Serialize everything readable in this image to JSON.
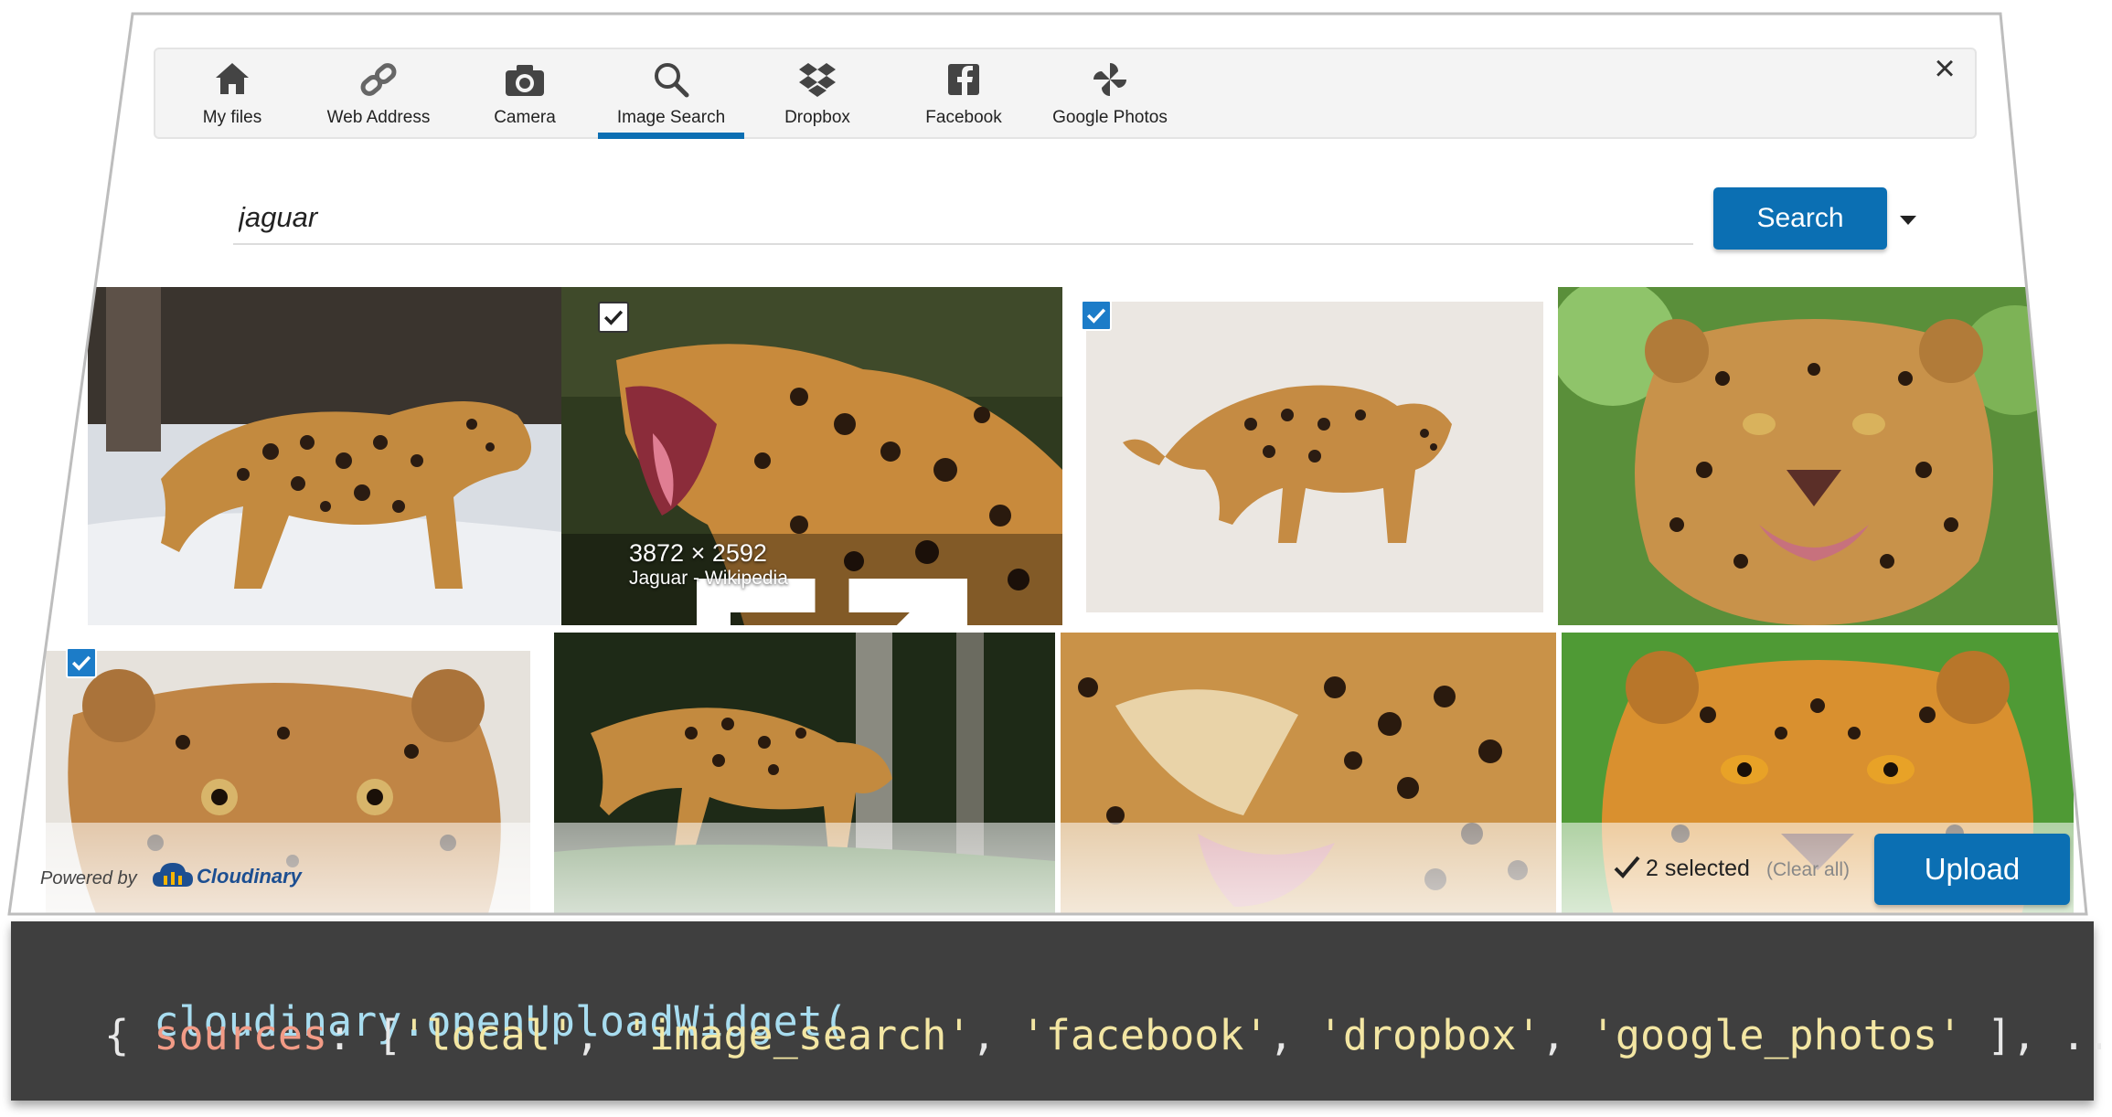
{
  "tabs": [
    {
      "label": "My files",
      "icon": "home-icon"
    },
    {
      "label": "Web Address",
      "icon": "link-icon"
    },
    {
      "label": "Camera",
      "icon": "camera-icon"
    },
    {
      "label": "Image Search",
      "icon": "search-icon",
      "active": true
    },
    {
      "label": "Dropbox",
      "icon": "dropbox-icon"
    },
    {
      "label": "Facebook",
      "icon": "facebook-icon"
    },
    {
      "label": "Google Photos",
      "icon": "google-photos-icon"
    }
  ],
  "close_label": "×",
  "search": {
    "value": "jaguar",
    "button_label": "Search"
  },
  "results": [
    {
      "selected": false
    },
    {
      "selected": false,
      "hover": true,
      "dimensions": "3872 × 2592",
      "source": "Jaguar - Wikipedia"
    },
    {
      "selected": true
    },
    {
      "selected": false
    },
    {
      "selected": true
    },
    {
      "selected": false
    },
    {
      "selected": false
    },
    {
      "selected": false
    }
  ],
  "footer": {
    "powered_by": "Powered by",
    "brand": "Cloudinary",
    "selected_text": "2 selected",
    "clear_all": "(Clear all)",
    "upload_label": "Upload"
  },
  "code": {
    "line1_fn": "cloudinary.openUploadWidget(",
    "line2_open": "  { ",
    "line2_key": "sources",
    "line2_colon": ": [",
    "s1": "'local'",
    "s2": "'image_search'",
    "s3": "'facebook'",
    "s4": "'dropbox'",
    "s5": "'google_photos'",
    "sep": ", ",
    "line2_close": " ], ..."
  },
  "colors": {
    "accent": "#0b6fb3",
    "code_bg": "#3f3f3f"
  }
}
